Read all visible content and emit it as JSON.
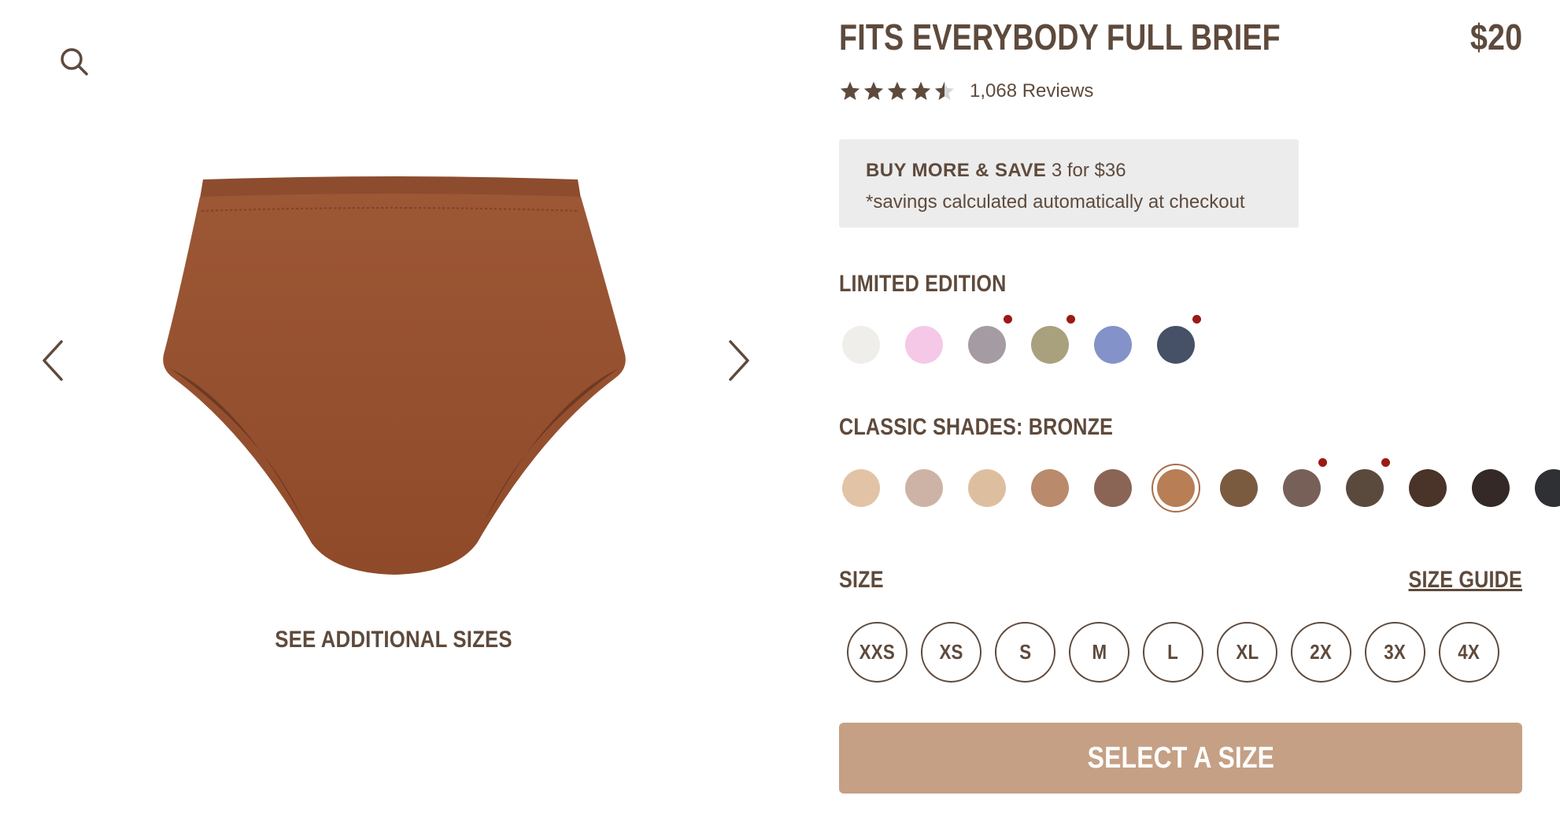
{
  "gallery": {
    "search_icon": "search-icon",
    "prev_icon": "chevron-left-icon",
    "next_icon": "chevron-right-icon",
    "product_color": "#9a5534",
    "see_additional_sizes": "SEE ADDITIONAL SIZES"
  },
  "product": {
    "title": "FITS EVERYBODY FULL BRIEF",
    "price": "$20",
    "rating_value": 4.5,
    "rating_max": 5,
    "reviews": "1,068 Reviews"
  },
  "promo": {
    "headline": "BUY MORE & SAVE",
    "offer": " 3 for $36",
    "note": "*savings calculated automatically at checkout"
  },
  "limited_edition": {
    "label": "LIMITED EDITION",
    "swatches": [
      {
        "color": "#efeeea",
        "new": false
      },
      {
        "color": "#f6c8e8",
        "new": false
      },
      {
        "color": "#a59ba2",
        "new": true
      },
      {
        "color": "#a9a07d",
        "new": true
      },
      {
        "color": "#8393c9",
        "new": false
      },
      {
        "color": "#465168",
        "new": true
      }
    ]
  },
  "classic_shades": {
    "label": "CLASSIC SHADES: BRONZE",
    "selected_index": 5,
    "swatches": [
      {
        "color": "#e3c3a5",
        "new": false
      },
      {
        "color": "#cdb3a5",
        "new": false
      },
      {
        "color": "#ddbfa0",
        "new": false
      },
      {
        "color": "#b98a6c",
        "new": false
      },
      {
        "color": "#8a6555",
        "new": false
      },
      {
        "color": "#b87e56",
        "new": false
      },
      {
        "color": "#7b5b3f",
        "new": false
      },
      {
        "color": "#776058",
        "new": true
      },
      {
        "color": "#5a4a3e",
        "new": true
      },
      {
        "color": "#4a3328",
        "new": false
      },
      {
        "color": "#352928",
        "new": false
      },
      {
        "color": "#2e3033",
        "new": false
      }
    ]
  },
  "size": {
    "label": "SIZE",
    "guide": "SIZE GUIDE",
    "options": [
      "XXS",
      "XS",
      "S",
      "M",
      "L",
      "XL",
      "2X",
      "3X",
      "4X"
    ]
  },
  "cta": {
    "label": "SELECT A SIZE"
  },
  "colors": {
    "text": "#5e4a3c",
    "cta": "#c5a085",
    "promo_bg": "#ececec",
    "star": "#5e4a3c",
    "star_empty": "#d6d6d6",
    "new_dot": "#9b1a14"
  }
}
